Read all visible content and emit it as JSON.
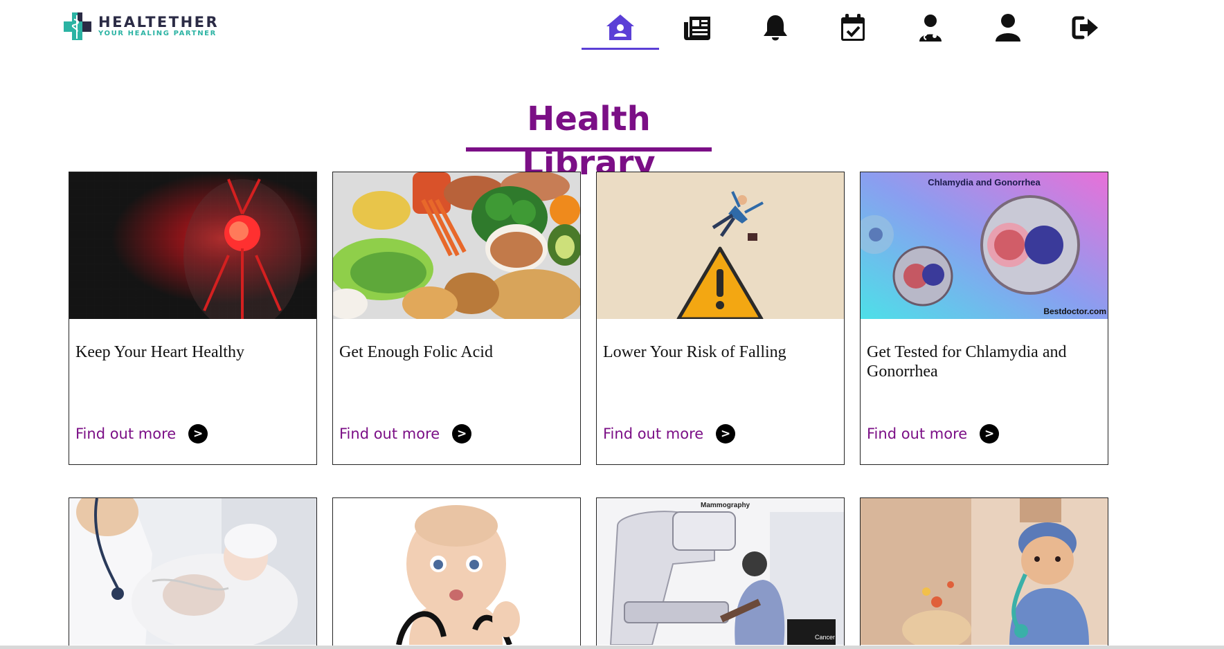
{
  "header": {
    "logo": {
      "name": "HEALTETHER",
      "tagline": "YOUR HEALING PARTNER"
    },
    "nav": [
      {
        "id": "home",
        "icon": "home-icon",
        "active": true
      },
      {
        "id": "news",
        "icon": "newspaper-icon",
        "active": false
      },
      {
        "id": "notifications",
        "icon": "bell-icon",
        "active": false
      },
      {
        "id": "appointments",
        "icon": "calendar-check-icon",
        "active": false
      },
      {
        "id": "doctors",
        "icon": "doctor-icon",
        "active": false
      },
      {
        "id": "profile",
        "icon": "user-icon",
        "active": false
      },
      {
        "id": "logout",
        "icon": "sign-out-icon",
        "active": false
      }
    ]
  },
  "main": {
    "title": "Health Library",
    "cards": [
      {
        "title": "Keep Your Heart Healthy",
        "link": "Find out more",
        "arrow": ">",
        "image": "heart-image"
      },
      {
        "title": "Get Enough Folic Acid",
        "link": "Find out more",
        "arrow": ">",
        "image": "food-image"
      },
      {
        "title": "Lower Your Risk of Falling",
        "link": "Find out more",
        "arrow": ">",
        "image": "falling-image"
      },
      {
        "title": "Get Tested for Chlamydia and Gonorrhea",
        "link": "Find out more",
        "arrow": ">",
        "image": "bacteria-image",
        "image_caption": "Chlamydia and Gonorrhea",
        "image_watermark": "Bestdoctor.com"
      },
      {
        "image": "newborn-image"
      },
      {
        "image": "baby-stethoscope-image"
      },
      {
        "image": "mammography-image",
        "image_caption": "Mammography",
        "image_label": "Cancer"
      },
      {
        "image": "child-doctor-image"
      }
    ]
  },
  "colors": {
    "accent": "#7b0f86",
    "nav_active": "#5b3fd6",
    "logo_teal": "#2bb3a3",
    "logo_dark": "#2b2b45"
  }
}
